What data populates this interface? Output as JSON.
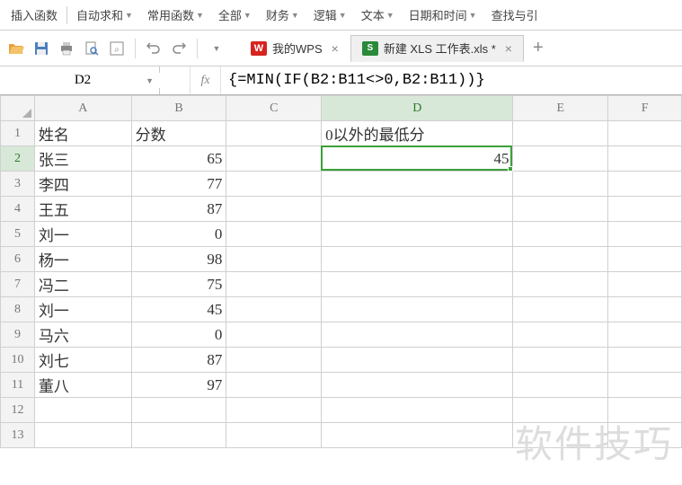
{
  "menubar": {
    "items": [
      {
        "label": "插入函数",
        "dropdown": false
      },
      {
        "label": "自动求和",
        "dropdown": true
      },
      {
        "label": "常用函数",
        "dropdown": true
      },
      {
        "label": "全部",
        "dropdown": true
      },
      {
        "label": "财务",
        "dropdown": true
      },
      {
        "label": "逻辑",
        "dropdown": true
      },
      {
        "label": "文本",
        "dropdown": true
      },
      {
        "label": "日期和时间",
        "dropdown": true
      },
      {
        "label": "查找与引",
        "dropdown": false
      }
    ]
  },
  "toolbar_icons": {
    "open": "open-folder-icon",
    "save": "save-icon",
    "print": "print-icon",
    "print_preview": "print-preview-icon",
    "find": "find-icon",
    "undo": "undo-icon",
    "redo": "redo-icon",
    "more": "more-icon"
  },
  "tabs": [
    {
      "label": "我的WPS",
      "kind": "wps",
      "active": false
    },
    {
      "label": "新建 XLS 工作表.xls *",
      "kind": "xls",
      "active": true
    }
  ],
  "formula_bar": {
    "name_box": "D2",
    "formula": "{=MIN(IF(B2:B11<>0,B2:B11))}"
  },
  "columns": [
    "A",
    "B",
    "C",
    "D",
    "E",
    "F"
  ],
  "row_count": 13,
  "headers": {
    "A": "姓名",
    "B": "分数",
    "D": "0以外的最低分"
  },
  "rows": [
    {
      "A": "张三",
      "B": 65
    },
    {
      "A": "李四",
      "B": 77
    },
    {
      "A": "王五",
      "B": 87
    },
    {
      "A": "刘一",
      "B": 0
    },
    {
      "A": "杨一",
      "B": 98
    },
    {
      "A": "冯二",
      "B": 75
    },
    {
      "A": "刘一",
      "B": 45
    },
    {
      "A": "马六",
      "B": 0
    },
    {
      "A": "刘七",
      "B": 87
    },
    {
      "A": "董八",
      "B": 97
    }
  ],
  "result_cell": {
    "col": "D",
    "row": 2,
    "value": 45
  },
  "active_cell": {
    "col": "D",
    "row": 2
  },
  "watermark": "软件技巧"
}
